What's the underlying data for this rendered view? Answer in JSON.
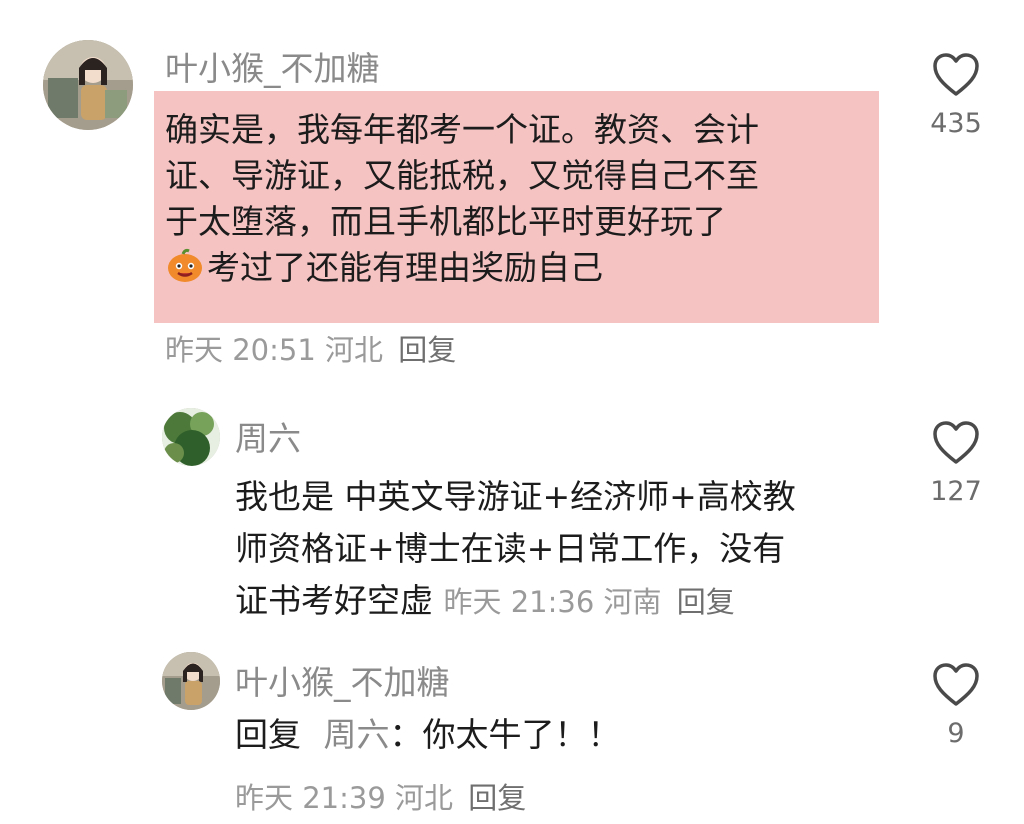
{
  "comments": [
    {
      "username": "叶小猴_不加糖",
      "text_lines": [
        "确实是，我每年都考一个证。教资、会计",
        "证、导游证，又能抵税，又觉得自己不至",
        "于太堕落，而且手机都比平时更好玩了",
        "考过了还能有理由奖励自己"
      ],
      "time": "昨天 20:51",
      "location": "河北",
      "reply_label": "回复",
      "likes": "435",
      "emoji": "pumpkin-face-icon"
    },
    {
      "username": "周六",
      "text_lines": [
        "我也是 中英文导游证+经济师+高校教",
        "师资格证+博士在读+日常工作，没有",
        "证书考好空虚"
      ],
      "time": "昨天 21:36",
      "location": "河南",
      "reply_label": "回复",
      "likes": "127"
    },
    {
      "username": "叶小猴_不加糖",
      "reply_prefix": "回复",
      "mention": "周六",
      "separator": "：",
      "text": "你太牛了！！",
      "time": "昨天 21:39",
      "location": "河北",
      "reply_label": "回复",
      "likes": "9"
    }
  ],
  "colors": {
    "highlight": "#f6c3c3",
    "username": "#8a8a8a",
    "meta": "#9a9a9a",
    "text": "#1c1c1c"
  },
  "icons": [
    "heart-outline-icon",
    "avatar"
  ]
}
